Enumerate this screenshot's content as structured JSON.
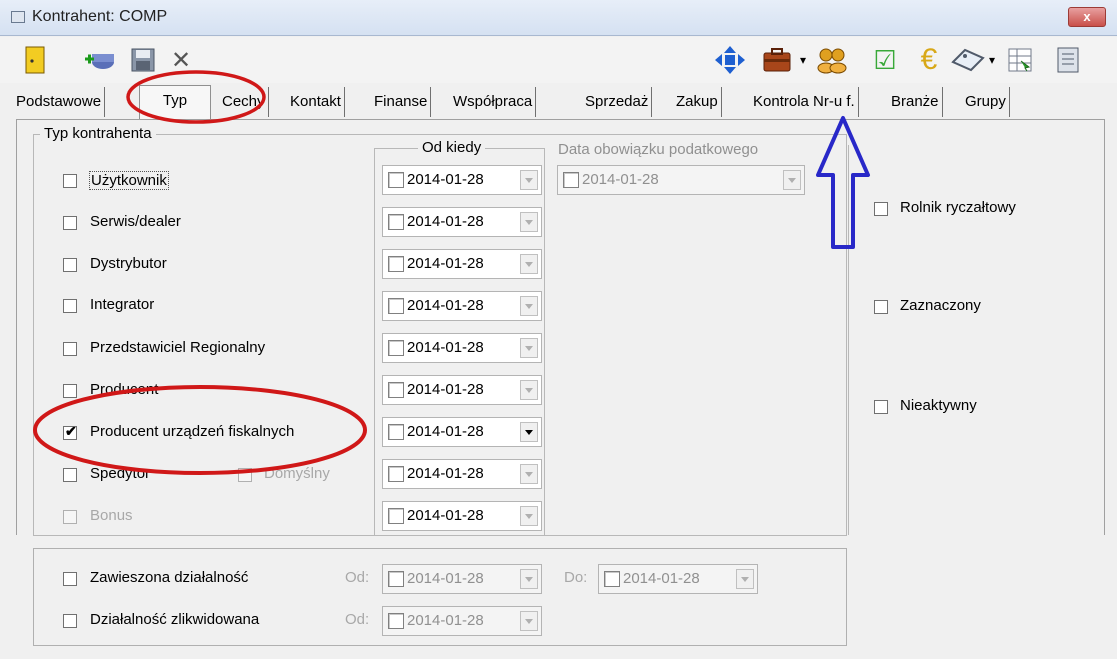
{
  "window": {
    "title": "Kontrahent: COMP",
    "close_label": "x"
  },
  "toolbar": {
    "left_icons": [
      "exit-door-icon",
      "add-contractor-icon",
      "save-disk-icon",
      "cancel-x-icon"
    ],
    "right_icons": [
      "navigation-arrows-icon",
      "briefcase-icon",
      "users-group-icon",
      "checklist-icon",
      "euro-icon",
      "tag-icon",
      "grid-list-icon",
      "document-icon"
    ],
    "cancel_glyph": "✕",
    "dropdown_glyph": "▾",
    "euro_glyph": "€",
    "check_glyph": "☑"
  },
  "tabs": [
    "Podstawowe",
    "Typ",
    "Cechy",
    "Kontakt",
    "Finanse",
    "Współpraca",
    "Sprzedaż",
    "Zakup",
    "Kontrola Nr-u f.",
    "Branże",
    "Grupy"
  ],
  "active_tab": "Typ",
  "type_group": {
    "title": "Typ kontrahenta",
    "items": [
      {
        "label": "Użytkownik",
        "checked": false,
        "disabled": false
      },
      {
        "label": "Serwis/dealer",
        "checked": false,
        "disabled": false
      },
      {
        "label": "Dystrybutor",
        "checked": false,
        "disabled": false
      },
      {
        "label": "Integrator",
        "checked": false,
        "disabled": false
      },
      {
        "label": "Przedstawiciel Regionalny",
        "checked": false,
        "disabled": false
      },
      {
        "label": "Producent",
        "checked": false,
        "disabled": false
      },
      {
        "label": "Producent urządzeń fiskalnych",
        "checked": true,
        "disabled": false
      },
      {
        "label": "Spedytor",
        "checked": false,
        "disabled": false
      },
      {
        "label": "Bonus",
        "checked": false,
        "disabled": true
      }
    ],
    "default_checkbox_label": "Domyślny",
    "check_mark": "✔"
  },
  "od_kiedy": {
    "title": "Od kiedy",
    "dates": [
      "2014-01-28",
      "2014-01-28",
      "2014-01-28",
      "2014-01-28",
      "2014-01-28",
      "2014-01-28",
      "2014-01-28",
      "2014-01-28",
      "2014-01-28"
    ]
  },
  "tax_date": {
    "label": "Data obowiązku podatkowego",
    "value": "2014-01-28"
  },
  "right_options": [
    {
      "label": "Rolnik ryczałtowy",
      "checked": false
    },
    {
      "label": "Zaznaczony",
      "checked": false
    },
    {
      "label": "Nieaktywny",
      "checked": false
    }
  ],
  "activity": {
    "suspended": {
      "label": "Zawieszona działalność",
      "from_label": "Od:",
      "from_value": "2014-01-28",
      "to_label": "Do:",
      "to_value": "2014-01-28"
    },
    "liquidated": {
      "label": "Działalność zlikwidowana",
      "from_label": "Od:",
      "from_value": "2014-01-28"
    }
  },
  "annotation_colors": {
    "ellipse": "#d01818",
    "arrow": "#2828c8"
  }
}
